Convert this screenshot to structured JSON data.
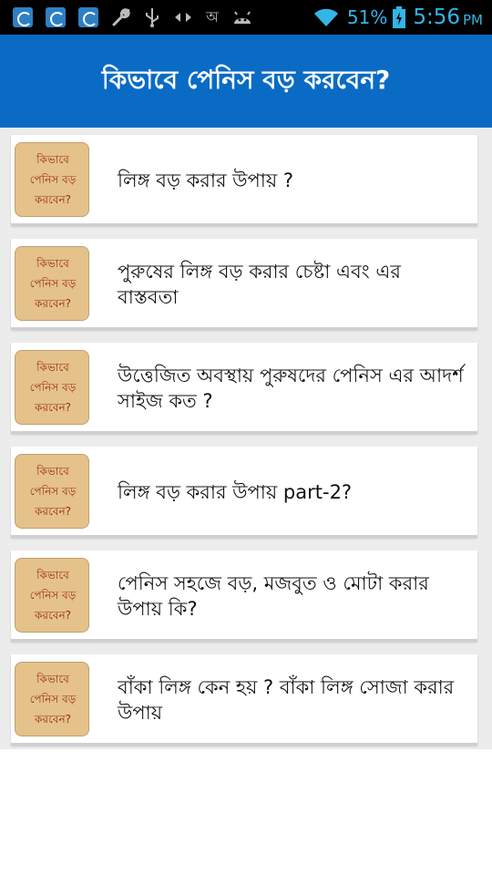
{
  "status_bar": {
    "icons": [
      "sync-icon",
      "sync-icon",
      "sync-icon",
      "wrench-icon",
      "usb-icon",
      "arrows-icon",
      "bengali-char-icon",
      "android-icon",
      "wifi-icon",
      "battery-icon"
    ],
    "bengali_char": "অ",
    "battery": "51%",
    "time": "5:56",
    "ampm": "PM"
  },
  "app_bar": {
    "title": "কিভাবে পেনিস বড় করবেন?"
  },
  "articles": [
    {
      "title": "লিঙ্গ বড় করার উপায় ?"
    },
    {
      "title": "পুরুষের লিঙ্গ বড় করার চেষ্টা এবং এর বাস্তবতা"
    },
    {
      "title": "উত্তেজিত অবস্থায় পুরুষদের পেনিস এর আদর্শ সাইজ কত ?"
    },
    {
      "title": "লিঙ্গ বড় করার উপায় part-2?"
    },
    {
      "title": "পেনিস সহজে বড়, মজবুত ও মোটা করার উপায় কি?"
    },
    {
      "title": "বাঁকা লিঙ্গ কেন হয় ? বাঁকা লিঙ্গ সোজা করার উপায়"
    }
  ],
  "thumbnail": {
    "line1": "কিভাবে",
    "line2": "পেনিস বড়",
    "line3": "করবেন?"
  },
  "colors": {
    "app_bar": "#0a6bc4",
    "status_text": "#33b5e5",
    "thumbnail_bg": "#e4c28a",
    "thumbnail_text": "#9b2a1a"
  }
}
